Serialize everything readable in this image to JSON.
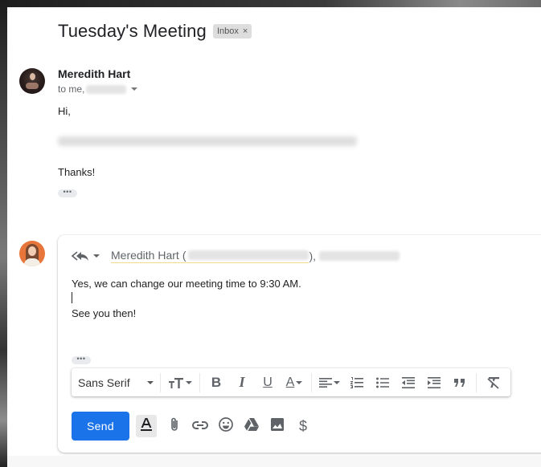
{
  "thread": {
    "subject": "Tuesday's Meeting",
    "label": "Inbox",
    "label_remove_glyph": "×"
  },
  "message": {
    "sender_name": "Meredith Hart",
    "to_prefix": "to me,",
    "greeting": "Hi,",
    "body_redacted": true,
    "closing": "Thanks!",
    "show_trimmed_glyph": "•••"
  },
  "compose": {
    "reply_mode_icon": "reply-all-icon",
    "recipient_name": "Meredith Hart",
    "recipient_open_paren": "(",
    "recipient_close_paren": "),",
    "body_lines": [
      "Yes, we can change our meeting time to 9:30 AM.",
      "",
      "See you then!"
    ],
    "show_trimmed_glyph": "•••",
    "formatting_toolbar": {
      "font": "Sans Serif",
      "buttons": [
        {
          "name": "text-size",
          "icon": "text-size-icon",
          "has_dropdown": true
        },
        {
          "name": "bold",
          "icon": "bold-icon",
          "glyph": "B"
        },
        {
          "name": "italic",
          "icon": "italic-icon",
          "glyph": "I"
        },
        {
          "name": "underline",
          "icon": "underline-icon",
          "glyph": "U"
        },
        {
          "name": "text-color",
          "icon": "text-color-icon",
          "glyph": "A",
          "has_dropdown": true
        },
        {
          "name": "align",
          "icon": "align-icon",
          "has_dropdown": true
        },
        {
          "name": "numbered-list",
          "icon": "numbered-list-icon"
        },
        {
          "name": "bulleted-list",
          "icon": "bulleted-list-icon"
        },
        {
          "name": "indent-less",
          "icon": "indent-less-icon"
        },
        {
          "name": "indent-more",
          "icon": "indent-more-icon"
        },
        {
          "name": "quote",
          "icon": "quote-icon",
          "glyph": "❞"
        },
        {
          "name": "remove-formatting",
          "icon": "remove-formatting-icon"
        }
      ]
    },
    "send_label": "Send",
    "bottom_actions": [
      {
        "name": "formatting-options",
        "icon": "text-format-icon",
        "active": true
      },
      {
        "name": "attach-files",
        "icon": "paperclip-icon"
      },
      {
        "name": "insert-link",
        "icon": "link-icon"
      },
      {
        "name": "insert-emoji",
        "icon": "emoji-icon"
      },
      {
        "name": "insert-drive",
        "icon": "drive-icon"
      },
      {
        "name": "insert-photo",
        "icon": "image-icon"
      },
      {
        "name": "send-money",
        "icon": "dollar-icon",
        "glyph": "$"
      }
    ]
  },
  "colors": {
    "send_button": "#1a73e8",
    "label_chip": "#dddddd",
    "recipient_underline": "#f2d98b"
  }
}
